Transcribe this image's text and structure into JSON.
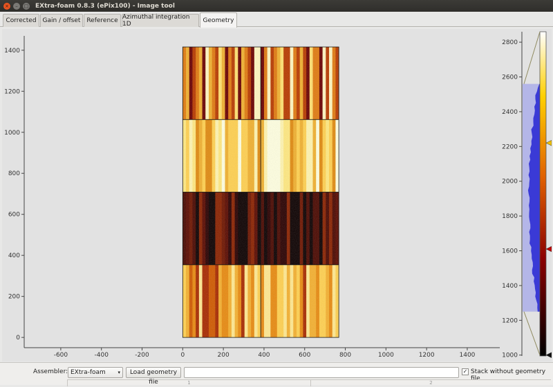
{
  "window": {
    "title": "EXtra-foam 0.8.3 (ePix100) - Image tool",
    "close_glyph": "×",
    "min_glyph": "–",
    "max_glyph": "□"
  },
  "tabs": [
    {
      "label": "Corrected",
      "active": false
    },
    {
      "label": "Gain / offset",
      "active": false
    },
    {
      "label": "Reference",
      "active": false
    },
    {
      "label": "Azimuthal integration 1D",
      "active": false
    },
    {
      "label": "Geometry",
      "active": true
    }
  ],
  "image_plot": {
    "x_ticks": [
      "-600",
      "-400",
      "-200",
      "0",
      "200",
      "400",
      "600",
      "800",
      "1000",
      "1200",
      "1400"
    ],
    "y_ticks": [
      "0",
      "200",
      "400",
      "600",
      "800",
      "1000",
      "1200",
      "1400"
    ],
    "x_range": [
      -780,
      1560
    ],
    "y_range": [
      -50,
      1470
    ],
    "image_extent": {
      "x": [
        0,
        768
      ],
      "y": [
        0,
        1416
      ]
    },
    "module_rows": 4,
    "module_cols": 2
  },
  "histogram": {
    "ticks": [
      "1000",
      "1200",
      "1400",
      "1600",
      "1800",
      "2000",
      "2200",
      "2400",
      "2600",
      "2800"
    ],
    "range": [
      995,
      2860
    ],
    "level_low": 1000,
    "level_high": 2860,
    "shaded_range": [
      1250,
      2560
    ],
    "marker_high": 2220,
    "marker_mid": 1610,
    "marker_low": 1000,
    "colors": {
      "shade": "#b4b6e8",
      "curve": "#3a3ad6",
      "marker_high": "#f0c000",
      "marker_mid": "#c00000",
      "marker_low": "#111111"
    }
  },
  "controls": {
    "assembler_label": "Assembler:",
    "assembler_value": "EXtra-foam",
    "assembler_arrow": "▾",
    "load_geometry_label": "Load geometry file",
    "geometry_path": "",
    "stack_checked": true,
    "stack_check_glyph": "✓",
    "stack_label": "Stack without geometry file",
    "col_headers": [
      "1",
      "2"
    ]
  }
}
